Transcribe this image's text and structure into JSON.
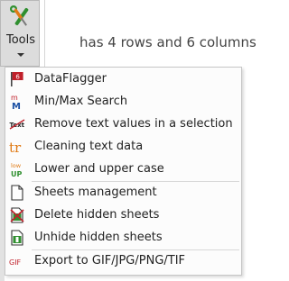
{
  "ribbon": {
    "tools_label": "Tools",
    "tools_icon": "tools-icon"
  },
  "background_text": "has 4 rows and 6 columns",
  "menu": {
    "items": [
      {
        "label": "DataFlagger",
        "icon": "dataflagger-icon"
      },
      {
        "label": "Min/Max Search",
        "icon": "min-max-search-icon"
      },
      {
        "label": "Remove text values in a selection",
        "icon": "remove-text-icon"
      },
      {
        "label": "Cleaning text data",
        "icon": "cleaning-text-icon"
      },
      {
        "label": "Lower and upper case",
        "icon": "lower-upper-case-icon"
      },
      {
        "label": "Sheets management",
        "icon": "sheets-management-icon"
      },
      {
        "label": "Delete hidden sheets",
        "icon": "delete-hidden-sheets-icon"
      },
      {
        "label": "Unhide hidden sheets",
        "icon": "unhide-hidden-sheets-icon"
      },
      {
        "label": "Export to GIF/JPG/PNG/TIF",
        "icon": "export-image-icon"
      }
    ],
    "icon_text": {
      "dataflagger": "6",
      "minmax_top": "m",
      "minmax_bottom": "M",
      "remove_text": "Text",
      "cleaning": "tr",
      "case_top": "low",
      "case_bottom": "UP",
      "export": "GIF"
    }
  },
  "colors": {
    "accent_red": "#c0202a",
    "accent_orange": "#e07b16",
    "accent_green": "#2f8f2f",
    "menu_bg": "#fcfcfc",
    "ribbon_bg": "#dcdcdc"
  }
}
